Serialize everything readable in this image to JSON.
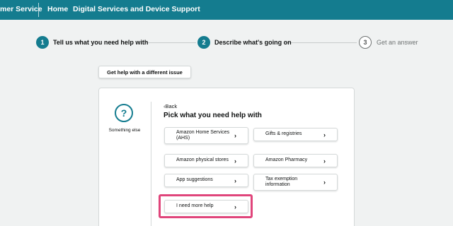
{
  "header": {
    "customer_service_label": "mer Service",
    "home_label": "Home",
    "digital_services_label": "Digital Services and Device Support"
  },
  "steps": [
    {
      "number": "1",
      "label": "Tell us what you need help with"
    },
    {
      "number": "2",
      "label": "Describe what's going on"
    },
    {
      "number": "3",
      "label": "Get an answer"
    }
  ],
  "other_issue_button": "Get help with a different issue",
  "card": {
    "category_icon_glyph": "?",
    "category_label": "Something else",
    "back_label": "Back",
    "title": "Pick what you need help with",
    "options": [
      {
        "label": "Amazon Home Services (AHS)"
      },
      {
        "label": "Gifts & registries"
      },
      {
        "label": "Amazon physical stores"
      },
      {
        "label": "Amazon Pharmacy"
      },
      {
        "label": "App suggestions"
      },
      {
        "label": "Tax exemption information"
      },
      {
        "label": "I need more help"
      }
    ]
  },
  "colors": {
    "accent": "#147c8f",
    "highlight": "#e0457b"
  }
}
